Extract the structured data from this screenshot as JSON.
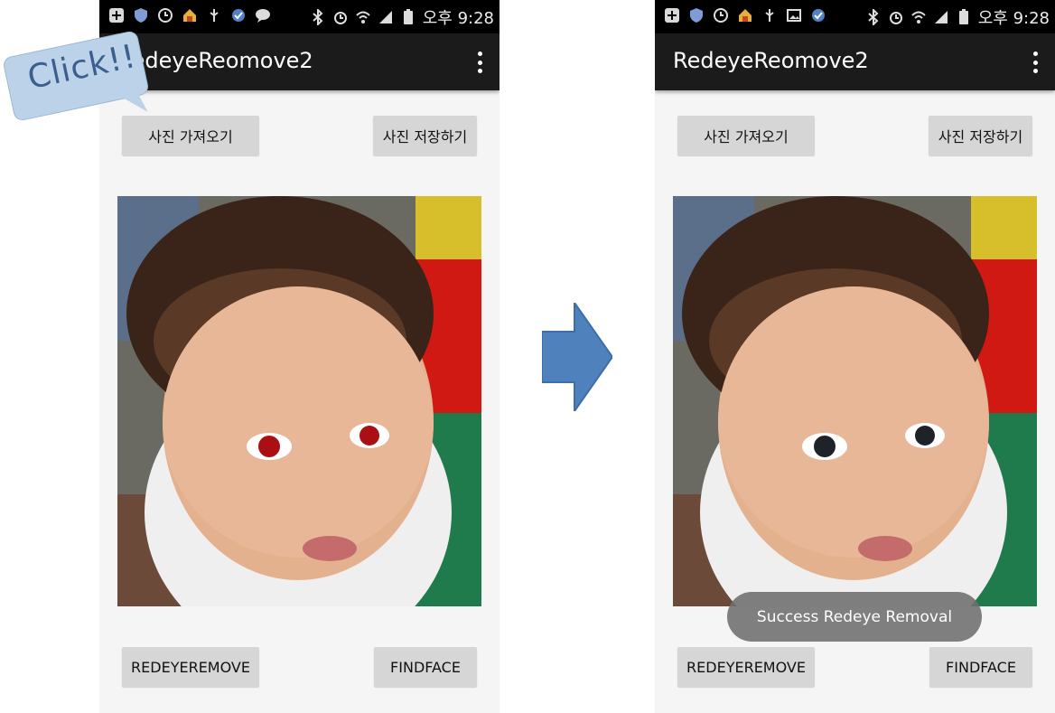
{
  "left_screen": {
    "status_time": "오후 9:28",
    "app_title": "RedeyeReomove2",
    "buttons": {
      "load_photo": "사진 가져오기",
      "save_photo": "사진 저장하기",
      "redeye_remove": "REDEYEREMOVE",
      "find_face": "FINDFACE"
    },
    "photo_state": "red-eye"
  },
  "annotation": {
    "callout_text": "Click!!",
    "arrow": "arrow-right"
  },
  "right_screen": {
    "status_time": "오후 9:28",
    "app_title": "RedeyeReomove2",
    "buttons": {
      "load_photo": "사진 가져오기",
      "save_photo": "사진 저장하기",
      "redeye_remove": "REDEYEREMOVE",
      "find_face": "FINDFACE"
    },
    "photo_state": "corrected",
    "toast": "Success Redeye Removal"
  },
  "colors": {
    "toolbar": "#1b1b1b",
    "button": "#d6d6d6",
    "arrow": "#4f81bd",
    "callout": "#bcd2e8"
  }
}
